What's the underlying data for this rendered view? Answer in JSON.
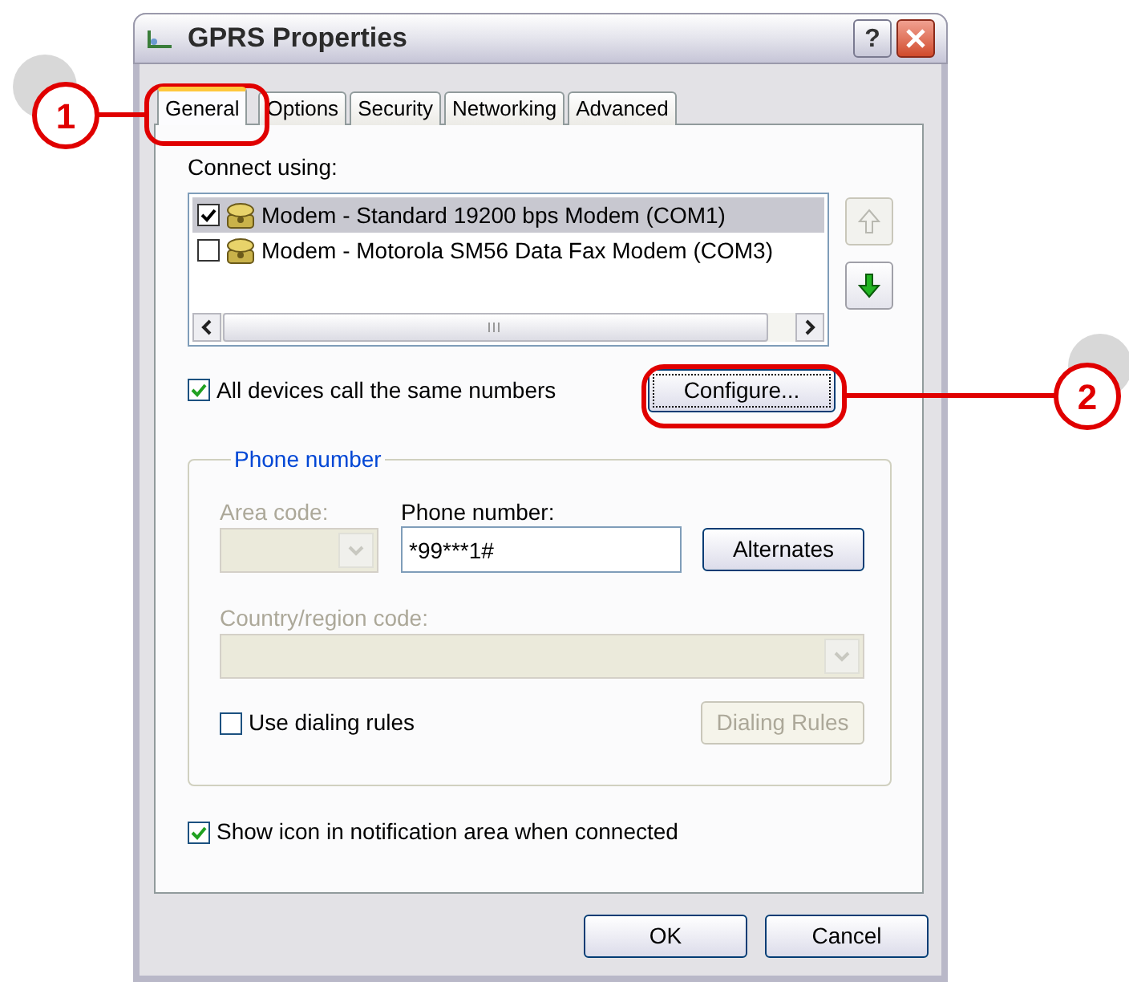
{
  "window": {
    "title": "GPRS Properties",
    "help_button": "?"
  },
  "tabs": [
    {
      "label": "General",
      "selected": true
    },
    {
      "label": "Options",
      "selected": false
    },
    {
      "label": "Security",
      "selected": false
    },
    {
      "label": "Networking",
      "selected": false
    },
    {
      "label": "Advanced",
      "selected": false
    }
  ],
  "connect_using": {
    "label": "Connect using:",
    "devices": [
      {
        "name": "Modem - Standard 19200 bps Modem (COM1)",
        "checked": true,
        "selected": true
      },
      {
        "name": "Modem - Motorola SM56 Data Fax Modem (COM3)",
        "checked": false,
        "selected": false
      }
    ],
    "move_up_button": {
      "disabled": true
    },
    "move_down_button": {
      "disabled": false
    }
  },
  "all_devices_same_numbers": {
    "label": "All devices call the same numbers",
    "checked": true
  },
  "configure_button": {
    "label": "Configure..."
  },
  "phone_group": {
    "title": "Phone number",
    "area_code": {
      "label": "Area code:",
      "disabled": true
    },
    "phone_number": {
      "label": "Phone number:",
      "value": "*99***1#"
    },
    "alternates_button": {
      "label": "Alternates"
    },
    "country_code": {
      "label": "Country/region code:",
      "disabled": true
    },
    "use_dialing_rules": {
      "label": "Use dialing rules",
      "checked": false
    },
    "dialing_rules_button": {
      "label": "Dialing Rules",
      "disabled": true
    }
  },
  "show_icon": {
    "label": "Show icon in notification area when connected",
    "checked": true
  },
  "buttons": [
    {
      "label": "OK"
    },
    {
      "label": "Cancel"
    }
  ],
  "annotations": [
    {
      "label": "1"
    },
    {
      "label": "2"
    }
  ]
}
